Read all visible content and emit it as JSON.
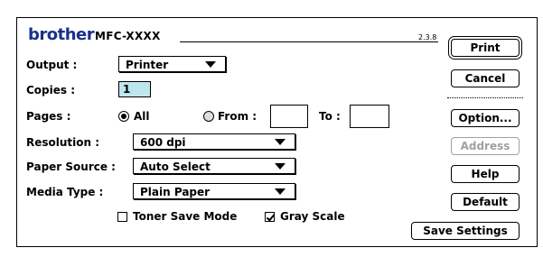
{
  "header": {
    "brand": "brother",
    "model": "MFC-XXXX",
    "version": "2.3.8"
  },
  "output": {
    "label": "Output :",
    "value": "Printer"
  },
  "copies": {
    "label": "Copies :",
    "value": "1"
  },
  "pages": {
    "label": "Pages :",
    "all_label": "All",
    "from_label": "From :",
    "to_label": "To :",
    "from_value": "",
    "to_value": "",
    "selected": "All"
  },
  "resolution": {
    "label": "Resolution :",
    "value": "600 dpi"
  },
  "paper_source": {
    "label": "Paper Source :",
    "value": "Auto Select"
  },
  "media_type": {
    "label": "Media Type :",
    "value": "Plain Paper"
  },
  "options": {
    "toner_save_label": "Toner Save Mode",
    "toner_save_checked": false,
    "gray_scale_label": "Gray Scale",
    "gray_scale_checked": true
  },
  "buttons": {
    "print": "Print",
    "cancel": "Cancel",
    "option": "Option...",
    "address": "Address",
    "help": "Help",
    "default": "Default",
    "save_settings": "Save Settings"
  },
  "colors": {
    "brand": "#1a2f8c",
    "copies_field": "#bfe6ef",
    "disabled_text": "#a0a0a0"
  }
}
